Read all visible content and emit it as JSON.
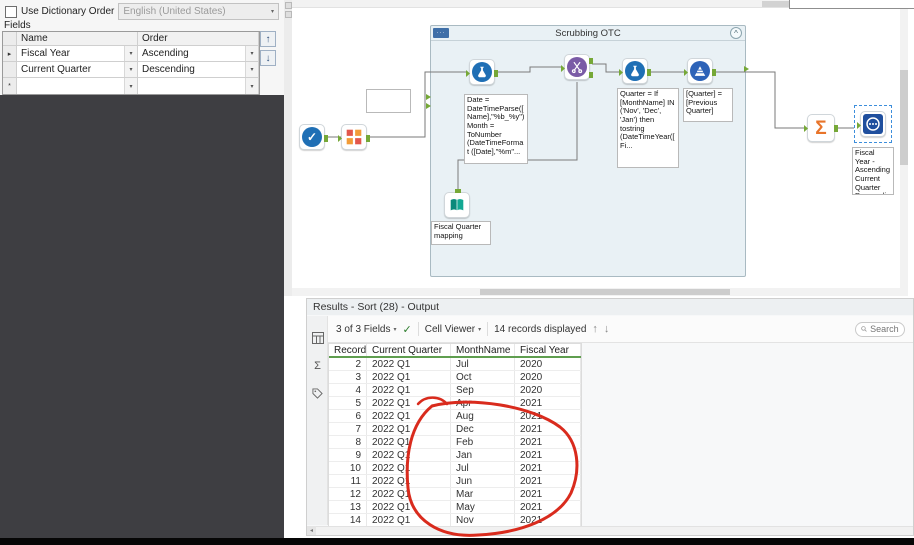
{
  "icons": {
    "chevron_down": "▾",
    "up_arrow": "↑",
    "down_arrow": "↓",
    "collapse_chevron": "^",
    "selected_row_marker": "▸",
    "new_row_marker": "*",
    "sigma": "Σ",
    "check": "✓",
    "dots": "···",
    "left_arrow": "◂"
  },
  "sort_config": {
    "dictionary_label": "Use Dictionary Order",
    "language_value": "English (United States)",
    "fields_label": "Fields",
    "grid_headers": [
      "Name",
      "Order"
    ],
    "grid_rows": [
      {
        "name": "Fiscal Year",
        "order": "Ascending",
        "selected": true,
        "new_row": false
      },
      {
        "name": "Current Quarter",
        "order": "Descending",
        "selected": false,
        "new_row": false
      },
      {
        "name": "",
        "order": "",
        "selected": false,
        "new_row": true
      }
    ]
  },
  "workflow": {
    "container_title": "Scrubbing OTC",
    "annotations": {
      "formula1": "Date = DateTimeParse([Name],\"%b_%y\")\nMonth = ToNumber (DateTimeFormat ([Date],\"%m\"...",
      "formula2": "Quarter = If [MonthName] IN ('Nov', 'Dec', 'Jan') then tostring (DateTimeYear([Fi...",
      "multirow": "[Quarter] = [Previous Quarter]",
      "book": "Fiscal Quarter mapping",
      "sort": "Fiscal Year - Ascending Current Quarter Descending"
    }
  },
  "results": {
    "title": "Results - Sort (28) - Output",
    "fields_summary": "3 of 3 Fields",
    "cell_viewer_label": "Cell Viewer",
    "records_label": "14 records displayed",
    "search_placeholder": "Search",
    "grid": {
      "headers": [
        "Record",
        "Current Quarter",
        "MonthName",
        "Fiscal Year"
      ],
      "rows": [
        [
          2,
          "2022 Q1",
          "Jul",
          "2020"
        ],
        [
          3,
          "2022 Q1",
          "Oct",
          "2020"
        ],
        [
          4,
          "2022 Q1",
          "Sep",
          "2020"
        ],
        [
          5,
          "2022 Q1",
          "Apr",
          "2021"
        ],
        [
          6,
          "2022 Q1",
          "Aug",
          "2021"
        ],
        [
          7,
          "2022 Q1",
          "Dec",
          "2021"
        ],
        [
          8,
          "2022 Q1",
          "Feb",
          "2021"
        ],
        [
          9,
          "2022 Q1",
          "Jan",
          "2021"
        ],
        [
          10,
          "2022 Q1",
          "Jul",
          "2021"
        ],
        [
          11,
          "2022 Q1",
          "Jun",
          "2021"
        ],
        [
          12,
          "2022 Q1",
          "Mar",
          "2021"
        ],
        [
          13,
          "2022 Q1",
          "May",
          "2021"
        ],
        [
          14,
          "2022 Q1",
          "Nov",
          "2021"
        ]
      ]
    }
  }
}
